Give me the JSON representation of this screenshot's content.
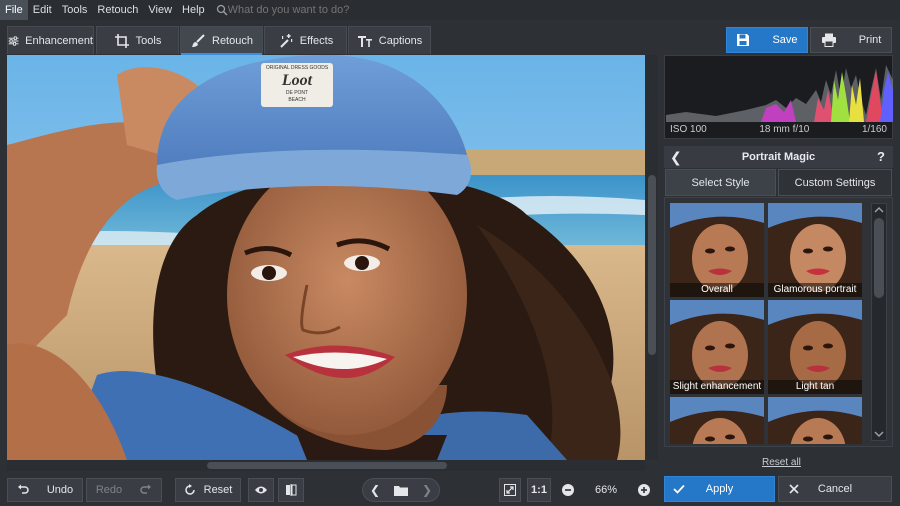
{
  "menu": {
    "items": [
      "File",
      "Edit",
      "Tools",
      "Retouch",
      "View",
      "Help"
    ],
    "active": "File",
    "search_placeholder": "What do you want to do?"
  },
  "tabs": {
    "enhancement": "Enhancement",
    "tools": "Tools",
    "retouch": "Retouch",
    "effects": "Effects",
    "captions": "Captions"
  },
  "actions": {
    "save": "Save",
    "print": "Print"
  },
  "histogram": {
    "iso": "ISO 100",
    "lens": "18 mm f/10",
    "shutter": "1/160"
  },
  "portrait_magic": {
    "title": "Portrait Magic",
    "help": "?",
    "tab_select": "Select Style",
    "tab_custom": "Custom Settings",
    "styles": [
      "Overall enhancement",
      "Glamorous portrait",
      "Slight enhancement",
      "Light tan",
      "",
      ""
    ],
    "reset_all": "Reset all"
  },
  "photo_badge": {
    "line1": "ORIGINAL DRESS GOODS",
    "line2": "Loot",
    "line3": "DE PONT",
    "line4": "BEACH"
  },
  "bottom": {
    "undo": "Undo",
    "redo": "Redo",
    "reset": "Reset",
    "actual_size": "1:1",
    "zoom": "66%",
    "apply": "Apply",
    "cancel": "Cancel"
  },
  "colors": {
    "accent": "#2f7fd1",
    "apply": "#2577c8",
    "save": "#2577c8"
  }
}
